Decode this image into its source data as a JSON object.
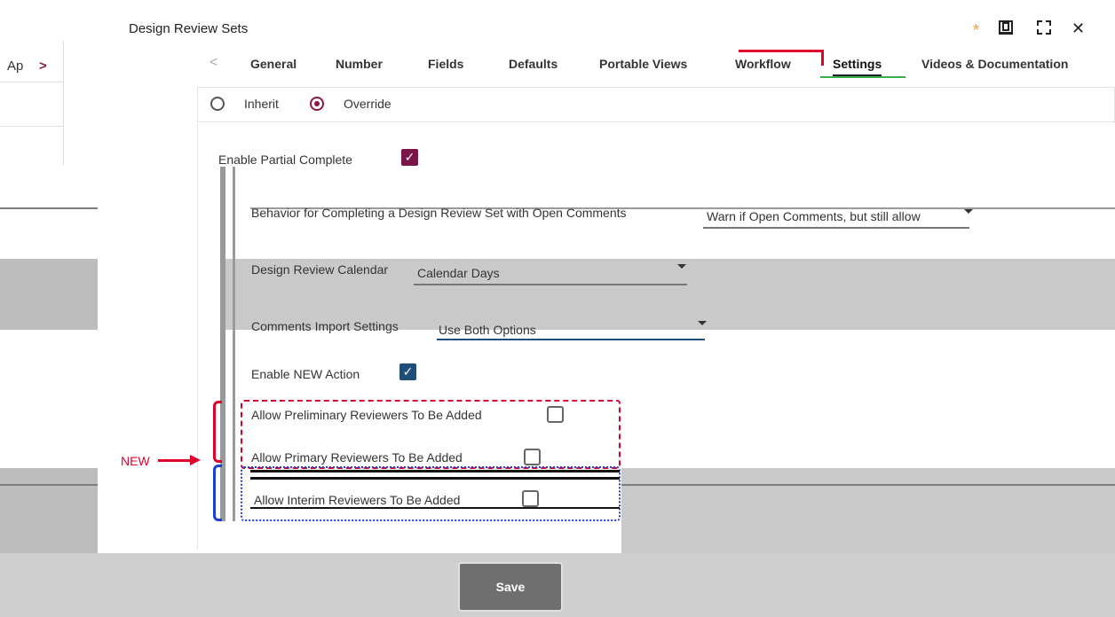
{
  "left_pane": {
    "header_text": "Ap",
    "chevron": "chevron-right-icon"
  },
  "window": {
    "title": "Design Review Sets",
    "icons": [
      "asterisk-icon",
      "popout-icon",
      "expand-icon",
      "close-icon"
    ],
    "asterisk": "*",
    "close": "✕"
  },
  "tabs": {
    "prev_icon": "chevron-left-icon",
    "items": [
      {
        "label": "General"
      },
      {
        "label": "Number"
      },
      {
        "label": "Fields"
      },
      {
        "label": "Defaults"
      },
      {
        "label": "Portable Views"
      },
      {
        "label": "Workflow"
      },
      {
        "label": "Settings"
      },
      {
        "label": "Videos & Documentation"
      }
    ],
    "active": "Settings"
  },
  "mode": {
    "inherit_label": "Inherit",
    "override_label": "Override",
    "selected": "Override"
  },
  "settings": {
    "enable_partial_complete": {
      "label": "Enable Partial Complete",
      "checked": true
    },
    "behavior": {
      "label": "Behavior for Completing a Design Review Set with Open Comments",
      "value": "Warn if Open Comments, but still allow"
    },
    "calendar": {
      "label": "Design Review Calendar",
      "value": "Calendar Days"
    },
    "comments_import": {
      "label": "Comments Import Settings",
      "value": "Use Both Options"
    },
    "enable_new_action": {
      "label": "Enable NEW Action",
      "checked": true
    },
    "allow_preliminary": {
      "label": "Allow Preliminary Reviewers To Be Added",
      "checked": false
    },
    "allow_primary": {
      "label": "Allow Primary Reviewers To Be Added",
      "checked": false
    },
    "allow_interim": {
      "label": "Allow Interim Reviewers To Be Added",
      "checked": false
    }
  },
  "annotation": {
    "new_label": "NEW"
  },
  "footer": {
    "save_label": "Save"
  },
  "colors": {
    "accent": "#7a1547",
    "blue_check": "#1f4e79",
    "annotation_red": "#e0002a",
    "annotation_blue": "#1e3fd6"
  }
}
